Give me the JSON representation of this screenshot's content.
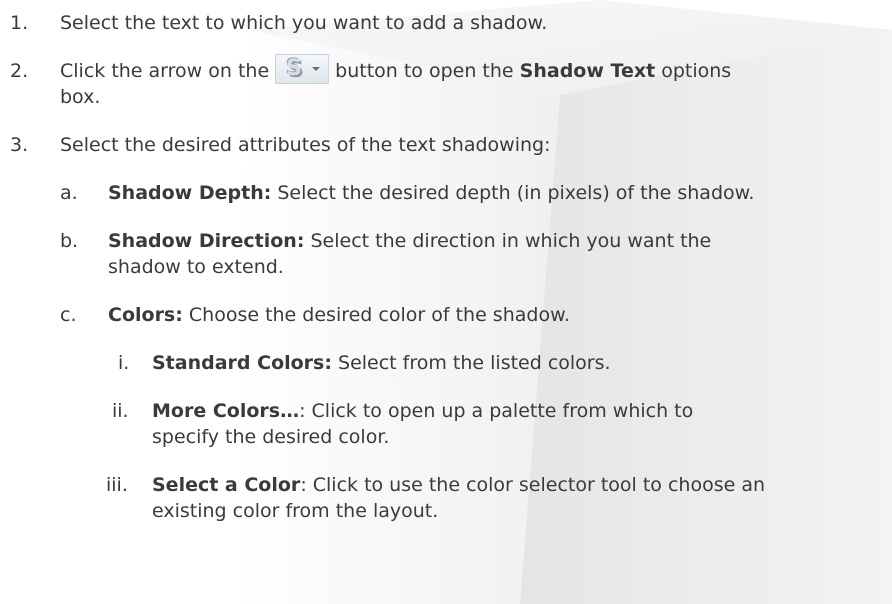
{
  "steps": [
    {
      "number": "1.",
      "text": "Select the text to which you want to add a shadow."
    },
    {
      "number": "2.",
      "pre": "Click the arrow on the",
      "post": "button to open the",
      "bold": "Shadow Text",
      "tail": "options",
      "cont": "box."
    },
    {
      "number": "3.",
      "text": "Select the desired attributes of the text shadowing:"
    }
  ],
  "sub_items": [
    {
      "letter": "a.",
      "bold": "Shadow Depth:",
      "text": " Select the desired depth (in pixels) of the shadow."
    },
    {
      "letter": "b.",
      "bold": "Shadow Direction:",
      "text": " Select the direction in which you want the",
      "cont": "shadow to extend."
    },
    {
      "letter": "c.",
      "bold": "Colors:",
      "text": " Choose the desired color of the shadow."
    }
  ],
  "roman_items": [
    {
      "numeral": "i.",
      "bold": "Standard Colors:",
      "text": " Select from the listed colors."
    },
    {
      "numeral": "ii.",
      "bold": "More Colors…",
      "text": ": Click to open up a palette from which to",
      "cont": "specify the desired color."
    },
    {
      "numeral": "iii.",
      "bold": "Select a Color",
      "text": ": Click to use the color selector tool to choose an",
      "cont": "existing color from the layout."
    }
  ],
  "shadow_button": {
    "glyph": "S",
    "icon": "shadow-text-icon"
  }
}
